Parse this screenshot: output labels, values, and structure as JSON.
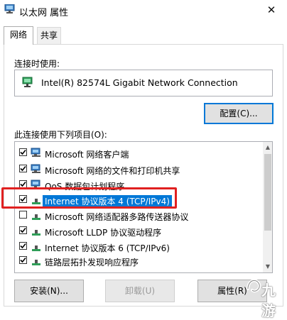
{
  "window": {
    "title": "以太网 属性",
    "close_glyph": "✕"
  },
  "tabs": [
    {
      "label": "网络",
      "active": true
    },
    {
      "label": "共享",
      "active": false
    }
  ],
  "connect_using": {
    "label": "连接时使用:",
    "adapter_name": "Intel(R) 82574L Gigabit Network Connection",
    "adapter_icon": "network-adapter-icon"
  },
  "configure_button": "配置(C)...",
  "items_label": "此连接使用下列项目(O):",
  "items": [
    {
      "label": "Microsoft 网络客户端",
      "checked": true,
      "icon": "network-client-icon",
      "selected": false
    },
    {
      "label": "Microsoft 网络的文件和打印机共享",
      "checked": true,
      "icon": "network-client-icon",
      "selected": false
    },
    {
      "label": "QoS 数据包计划程序",
      "checked": true,
      "icon": "network-client-icon",
      "selected": false
    },
    {
      "label": "Internet 协议版本 4 (TCP/IPv4)",
      "checked": true,
      "icon": "protocol-icon",
      "selected": true
    },
    {
      "label": "Microsoft 网络适配器多路传送器协议",
      "checked": false,
      "icon": "protocol-icon",
      "selected": false
    },
    {
      "label": "Microsoft LLDP 协议驱动程序",
      "checked": true,
      "icon": "protocol-icon",
      "selected": false
    },
    {
      "label": "Internet 协议版本 6 (TCP/IPv6)",
      "checked": true,
      "icon": "protocol-icon",
      "selected": false
    },
    {
      "label": "链路层拓扑发现响应程序",
      "checked": true,
      "icon": "protocol-icon",
      "selected": false
    }
  ],
  "buttons": {
    "install": "安装(N)...",
    "uninstall": "卸载(U)",
    "properties": "属性(R)"
  },
  "watermark": {
    "text": "九游",
    "icon": "watermark-logo-icon"
  },
  "colors": {
    "selection": "#0078d7",
    "highlight_box": "#e02020"
  }
}
